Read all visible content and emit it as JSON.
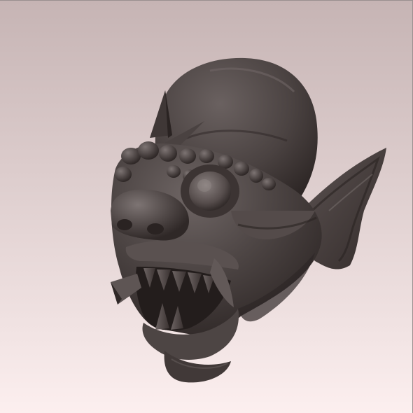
{
  "viewport": {
    "background_top": "#c6b4b4",
    "background_bottom": "#fcefef",
    "subject": "sculpted-creature-head",
    "material_color": "#4e4645",
    "material_shadow": "#2a2322",
    "material_highlight": "#8a8180"
  }
}
